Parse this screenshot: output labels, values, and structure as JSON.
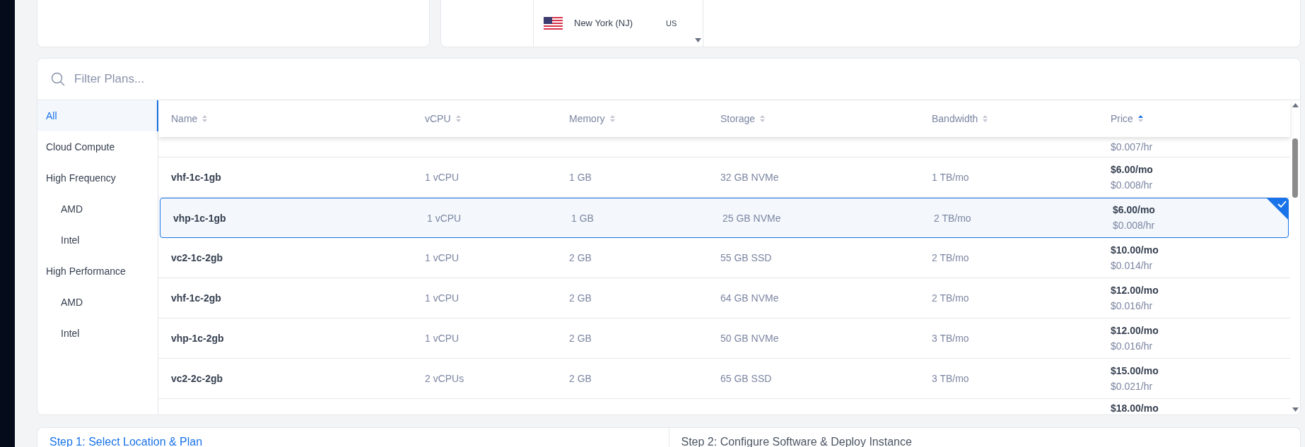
{
  "location_list": {
    "items": [
      {
        "name": "New York (NJ)",
        "country": "US"
      }
    ]
  },
  "filter": {
    "placeholder": "Filter Plans..."
  },
  "sidebar": {
    "items": [
      {
        "label": "All",
        "selected": true
      },
      {
        "label": "Cloud Compute",
        "selected": false
      },
      {
        "label": "High Frequency",
        "selected": false,
        "children": [
          {
            "label": "AMD",
            "selected": false
          },
          {
            "label": "Intel",
            "selected": false
          }
        ]
      },
      {
        "label": "High Performance",
        "selected": false,
        "children": [
          {
            "label": "AMD",
            "selected": false
          },
          {
            "label": "Intel",
            "selected": false
          }
        ]
      }
    ]
  },
  "table": {
    "columns": [
      {
        "label": "Name",
        "sorted": false
      },
      {
        "label": "vCPU",
        "sorted": false
      },
      {
        "label": "Memory",
        "sorted": false
      },
      {
        "label": "Storage",
        "sorted": false
      },
      {
        "label": "Bandwidth",
        "sorted": false
      },
      {
        "label": "Price",
        "sorted": true
      }
    ],
    "rows": [
      {
        "kind": "partial_top",
        "selected": false,
        "hourly": "$0.007/hr"
      },
      {
        "kind": "full",
        "selected": false,
        "name": "vhf-1c-1gb",
        "vcpu": "1 vCPU",
        "memory": "1 GB",
        "storage": "32 GB NVMe",
        "bandwidth": "1 TB/mo",
        "monthly": "$6.00/mo",
        "hourly": "$0.008/hr"
      },
      {
        "kind": "full",
        "selected": true,
        "name": "vhp-1c-1gb",
        "vcpu": "1 vCPU",
        "memory": "1 GB",
        "storage": "25 GB NVMe",
        "bandwidth": "2 TB/mo",
        "monthly": "$6.00/mo",
        "hourly": "$0.008/hr"
      },
      {
        "kind": "full",
        "selected": false,
        "name": "vc2-1c-2gb",
        "vcpu": "1 vCPU",
        "memory": "2 GB",
        "storage": "55 GB SSD",
        "bandwidth": "2 TB/mo",
        "monthly": "$10.00/mo",
        "hourly": "$0.014/hr"
      },
      {
        "kind": "full",
        "selected": false,
        "name": "vhf-1c-2gb",
        "vcpu": "1 vCPU",
        "memory": "2 GB",
        "storage": "64 GB NVMe",
        "bandwidth": "2 TB/mo",
        "monthly": "$12.00/mo",
        "hourly": "$0.016/hr"
      },
      {
        "kind": "full",
        "selected": false,
        "name": "vhp-1c-2gb",
        "vcpu": "1 vCPU",
        "memory": "2 GB",
        "storage": "50 GB NVMe",
        "bandwidth": "3 TB/mo",
        "monthly": "$12.00/mo",
        "hourly": "$0.016/hr"
      },
      {
        "kind": "full",
        "selected": false,
        "name": "vc2-2c-2gb",
        "vcpu": "2 vCPUs",
        "memory": "2 GB",
        "storage": "65 GB SSD",
        "bandwidth": "3 TB/mo",
        "monthly": "$15.00/mo",
        "hourly": "$0.021/hr"
      },
      {
        "kind": "partial_bottom",
        "selected": false,
        "monthly": "$18.00/mo"
      }
    ]
  },
  "steps": [
    {
      "label": "Step 1: Select Location & Plan",
      "selected": true
    },
    {
      "label": "Step 2: Configure Software & Deploy Instance",
      "selected": false
    }
  ]
}
